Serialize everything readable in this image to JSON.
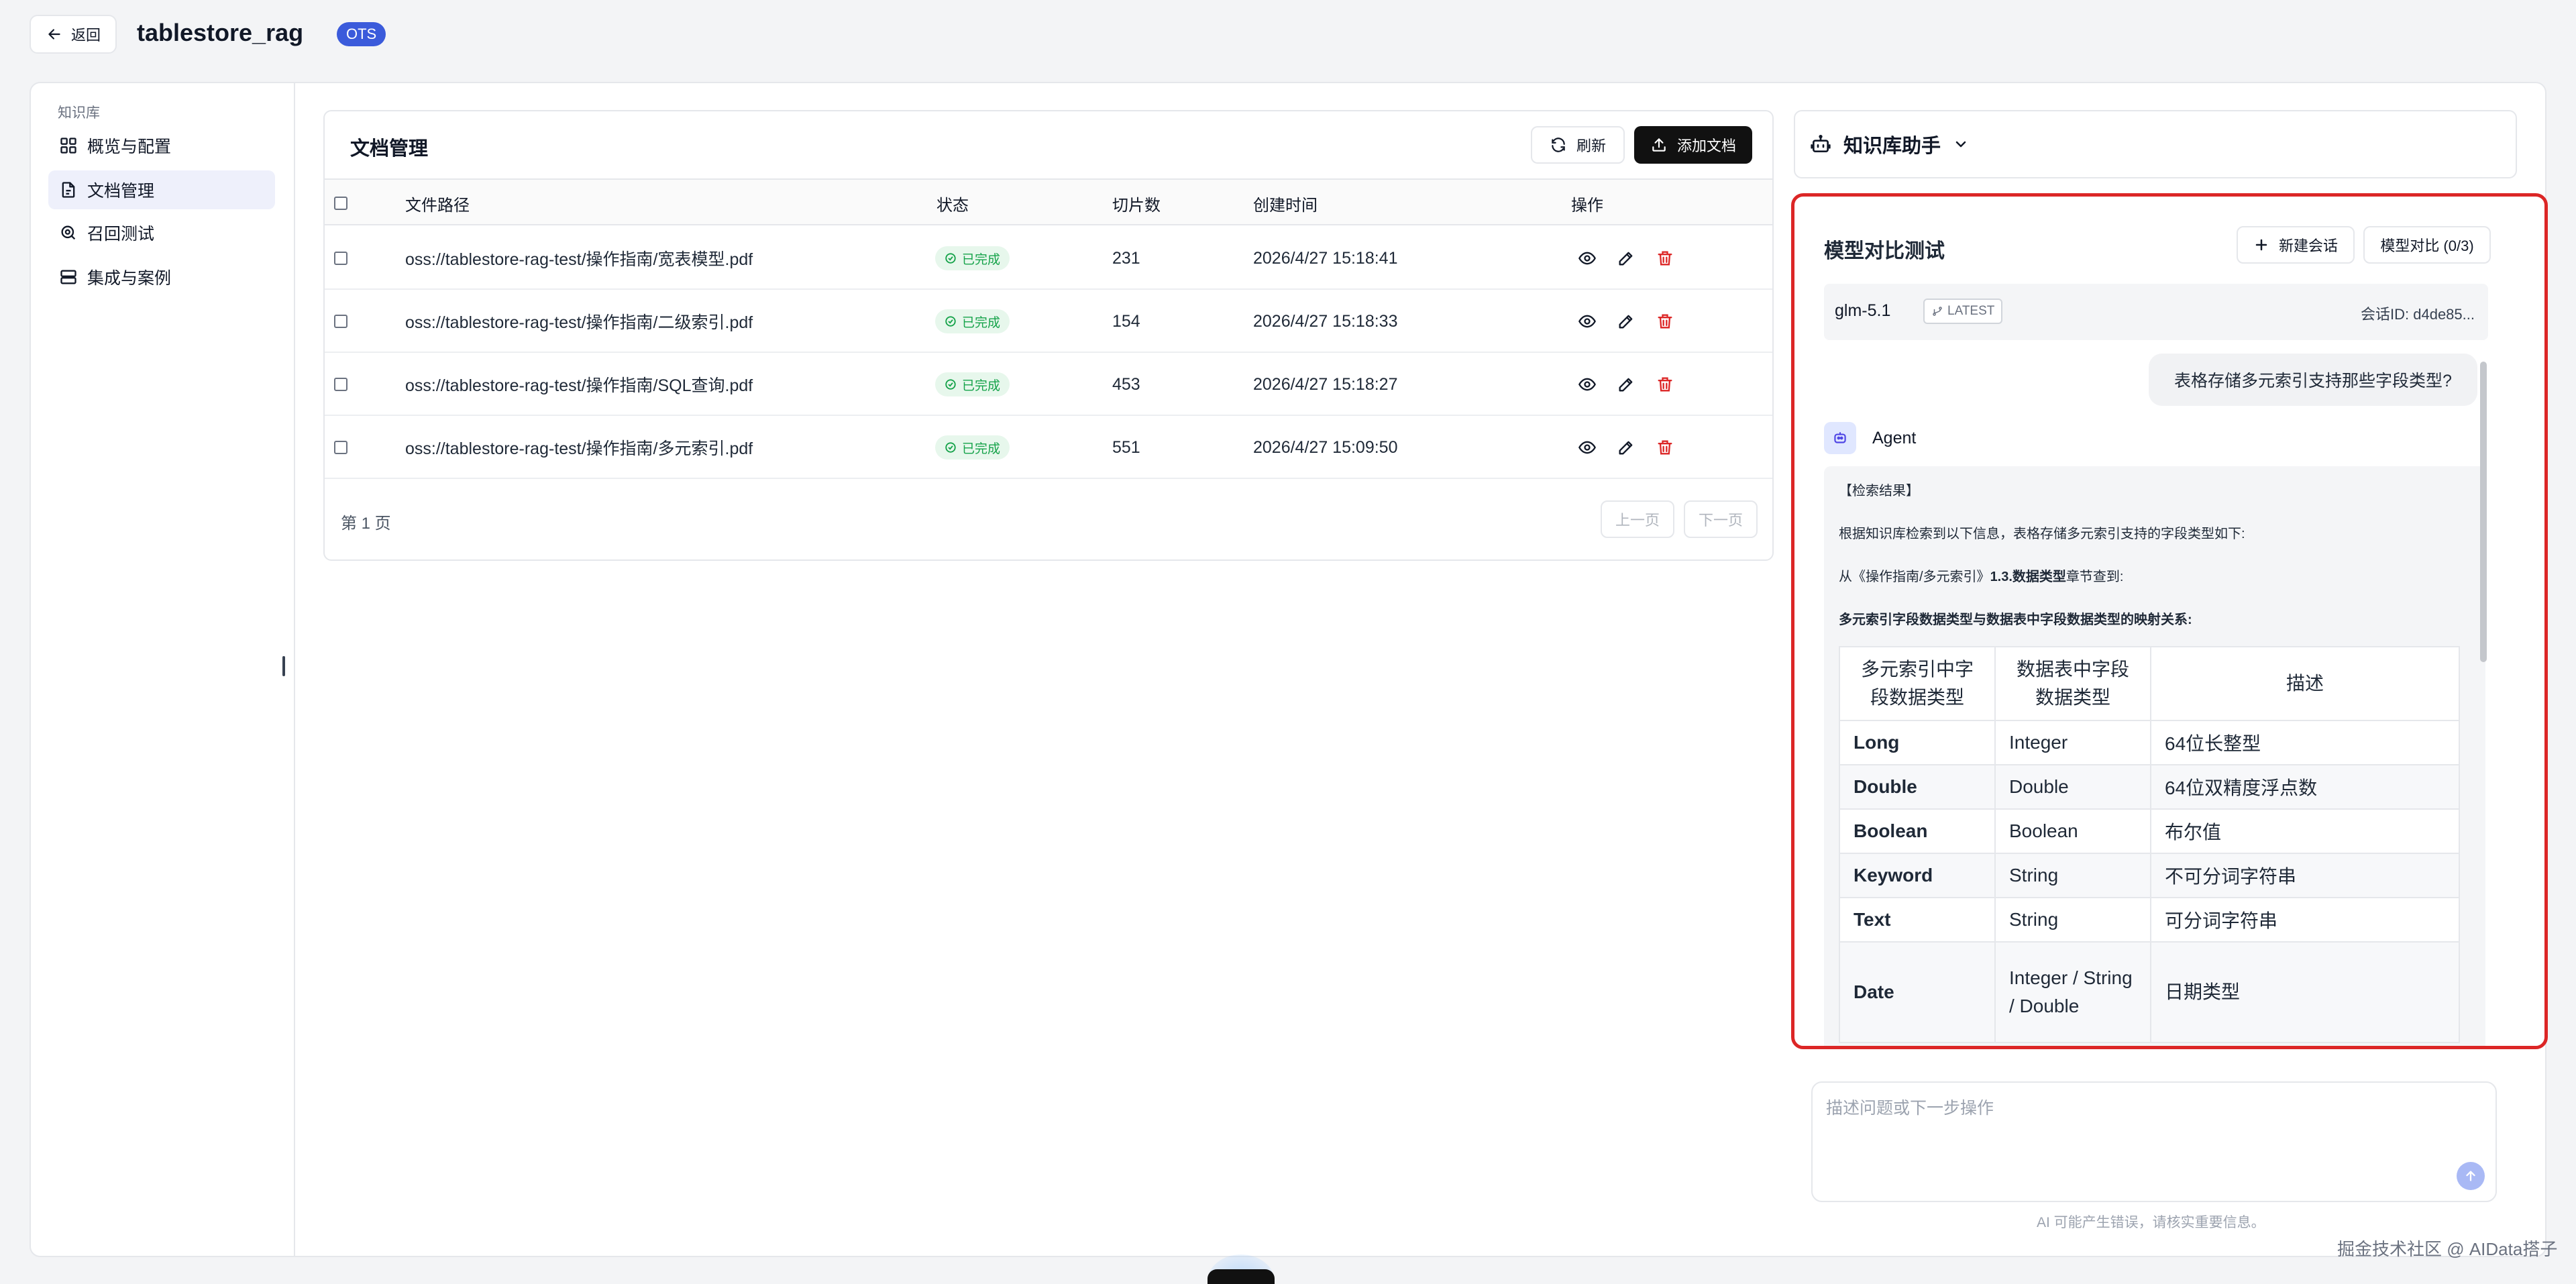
{
  "header": {
    "back_label": "返回",
    "app_title": "tablestore_rag",
    "badge": "OTS"
  },
  "sidebar": {
    "group_label": "知识库",
    "items": [
      {
        "label": "概览与配置",
        "icon": "grid-icon",
        "active": false
      },
      {
        "label": "文档管理",
        "icon": "document-icon",
        "active": true
      },
      {
        "label": "召回测试",
        "icon": "search-icon",
        "active": false
      },
      {
        "label": "集成与案例",
        "icon": "server-icon",
        "active": false
      }
    ]
  },
  "documents": {
    "title": "文档管理",
    "refresh_label": "刷新",
    "add_label": "添加文档",
    "columns": [
      "文件路径",
      "状态",
      "切片数",
      "创建时间",
      "操作"
    ],
    "rows": [
      {
        "path": "oss://tablestore-rag-test/操作指南/宽表模型.pdf",
        "status": "已完成",
        "chunks": "231",
        "created": "2026/4/27 15:18:41"
      },
      {
        "path": "oss://tablestore-rag-test/操作指南/二级索引.pdf",
        "status": "已完成",
        "chunks": "154",
        "created": "2026/4/27 15:18:33"
      },
      {
        "path": "oss://tablestore-rag-test/操作指南/SQL查询.pdf",
        "status": "已完成",
        "chunks": "453",
        "created": "2026/4/27 15:18:27"
      },
      {
        "path": "oss://tablestore-rag-test/操作指南/多元索引.pdf",
        "status": "已完成",
        "chunks": "551",
        "created": "2026/4/27 15:09:50"
      }
    ],
    "page_label": "第 1 页",
    "prev_label": "上一页",
    "next_label": "下一页"
  },
  "assistant": {
    "title": "知识库助手",
    "panel_title": "模型对比测试",
    "new_session_label": "新建会话",
    "compare_label": "模型对比 (0/3)",
    "model_name": "glm-5.1",
    "model_tag": "LATEST",
    "session_id": "会话ID: d4de85...",
    "user_question": "表格存储多元索引支持那些字段类型?",
    "agent_name": "Agent",
    "answer": {
      "line1": "【检索结果】",
      "line2": "根据知识库检索到以下信息，表格存储多元索引支持的字段类型如下:",
      "line3_prefix": "从《操作指南/多元索引》",
      "line3_bold": "1.3.数据类型",
      "line3_suffix": "章节查到:",
      "line4": "多元索引字段数据类型与数据表中字段数据类型的映射关系:",
      "table_headers": [
        "多元索引中字段数据类型",
        "数据表中字段数据类型",
        "描述"
      ],
      "table_rows": [
        {
          "index_type": "Long",
          "table_type": "Integer",
          "desc": "64位长整型"
        },
        {
          "index_type": "Double",
          "table_type": "Double",
          "desc": "64位双精度浮点数"
        },
        {
          "index_type": "Boolean",
          "table_type": "Boolean",
          "desc": "布尔值"
        },
        {
          "index_type": "Keyword",
          "table_type": "String",
          "desc": "不可分词字符串"
        },
        {
          "index_type": "Text",
          "table_type": "String",
          "desc": "可分词字符串"
        },
        {
          "index_type": "Date",
          "table_type": "Integer / String / Double",
          "desc": "日期类型"
        }
      ]
    },
    "input_placeholder": "描述问题或下一步操作",
    "disclaimer": "AI 可能产生错误，请核实重要信息。"
  },
  "watermark": "掘金技术社区 @ AIData搭子",
  "colors": {
    "accent": "#3b5bdb",
    "highlight_border": "#dc2626",
    "success": "#16a34a",
    "danger": "#dc2626"
  }
}
